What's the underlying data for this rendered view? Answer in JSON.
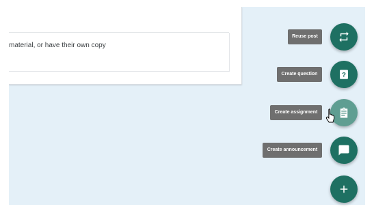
{
  "post_card": {
    "material_text": "material, or have their own copy"
  },
  "fab_menu": {
    "items": [
      {
        "label": "Reuse post",
        "icon": "repeat-icon"
      },
      {
        "label": "Create question",
        "icon": "question-icon"
      },
      {
        "label": "Create assignment",
        "icon": "clipboard-icon",
        "state": "hovered"
      },
      {
        "label": "Create announcement",
        "icon": "chat-icon"
      }
    ],
    "main_button_icon": "plus-icon"
  },
  "colors": {
    "fab": "#1e7062",
    "fab_hover": "#5f9e92",
    "tooltip": "#6f6f6f",
    "background": "#e4f0f8"
  }
}
